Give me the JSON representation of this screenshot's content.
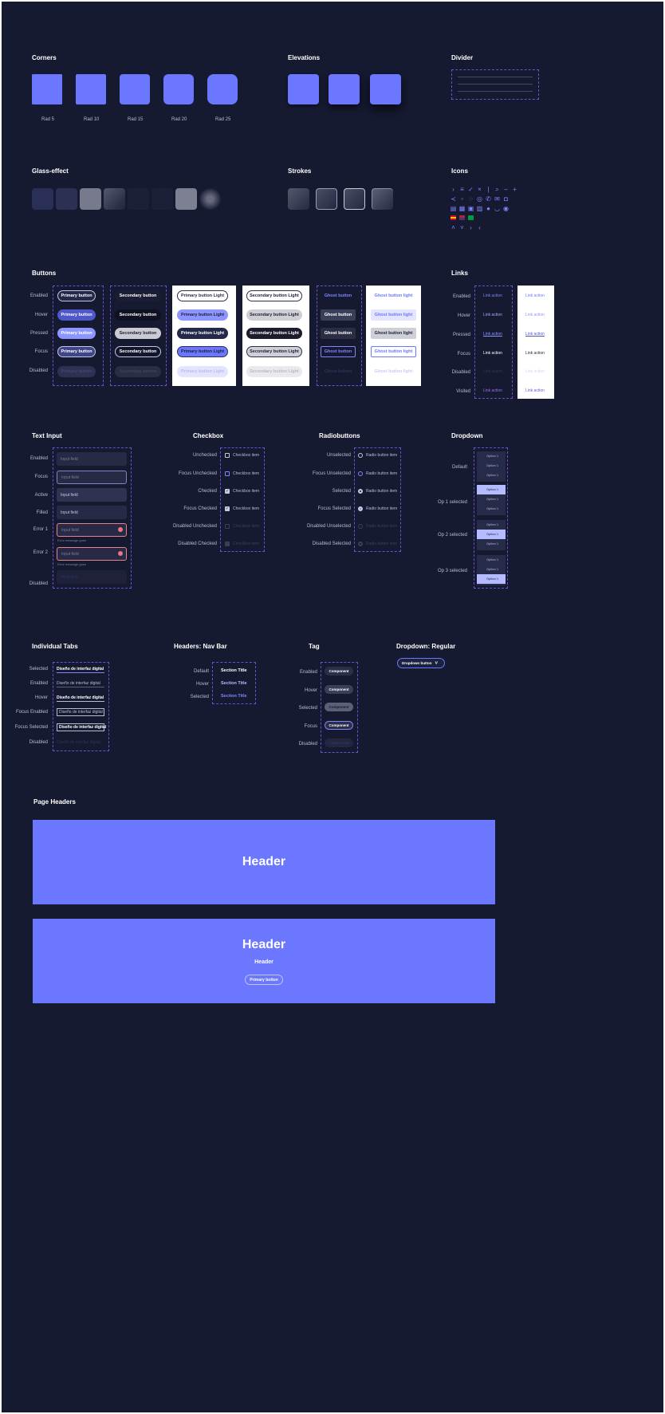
{
  "colors": {
    "bg": "#161a31",
    "accent": "#6c77ff",
    "light": "#b5bbff",
    "dashed": "#6a4fd0"
  },
  "sections": {
    "corners": "Corners",
    "elevations": "Elevations",
    "divider": "Divider",
    "glass": "Glass-effect",
    "strokes": "Strokes",
    "icons": "Icons",
    "buttons": "Buttons",
    "links": "Links",
    "text_input": "Text Input",
    "checkbox": "Checkbox",
    "radio": "Radiobuttons",
    "dropdown": "Dropdown",
    "tabs": "Individual Tabs",
    "navbar": "Headers: Nav Bar",
    "tag": "Tag",
    "dropdown_regular": "Dropdown: Regular",
    "page_headers": "Page Headers"
  },
  "corners": [
    "Rad 5",
    "Rad 10",
    "Rad 15",
    "Rad 20",
    "Rad 25"
  ],
  "states": [
    "Enabled",
    "Hover",
    "Pressed",
    "Focus",
    "Disabled"
  ],
  "buttons": {
    "primary": "Primary button",
    "secondary": "Secondary button",
    "primary_light": "Primary button Light",
    "secondary_light": "Secondary button Light",
    "ghost": "Ghost button",
    "ghost_light": "Ghost button light"
  },
  "links": {
    "states": [
      "Enabled",
      "Hover",
      "Pressed",
      "Focus",
      "Disabled",
      "Visited"
    ],
    "label": "Link action"
  },
  "text_input": {
    "states": [
      "Enabled",
      "Focus",
      "Active",
      "Filled",
      "Error 1",
      "Error 2",
      "Disabled"
    ],
    "values": [
      "Input field",
      "Input field",
      "Input field",
      "Input field",
      "Input field",
      "Input field",
      "Input field"
    ],
    "error_msg": "Error message goes"
  },
  "checkbox": {
    "states": [
      "Unchecked",
      "Focus Unchecked",
      "Checked",
      "Focus Checked",
      "Disabled Unchecked",
      "Disabled Checked"
    ],
    "label": "Checkbox item"
  },
  "radio": {
    "states": [
      "Unselected",
      "Focus Unselected",
      "Selected",
      "Focus Selected",
      "Disabled Unselected",
      "Disabled Selected"
    ],
    "label": "Radio button item"
  },
  "dropdown": {
    "states": [
      "Default",
      "Op 1 selected",
      "Op 2 selected",
      "Op 3 selected"
    ],
    "option": "Option 1"
  },
  "tabs": {
    "states": [
      "Selected",
      "Enabled",
      "Hover",
      "Focus Enabled",
      "Focus Selected",
      "Disabled"
    ],
    "label": "Diseño de interfaz digital"
  },
  "navbar": {
    "states": [
      "Default",
      "Hover",
      "Selected"
    ],
    "label": "Section Title"
  },
  "tag": {
    "states": [
      "Enabled",
      "Hover",
      "Selected",
      "Focus",
      "Disabled"
    ],
    "label": "Component"
  },
  "dropdown_regular": {
    "label": "Dropdown button"
  },
  "page_headers": {
    "header1": "Header",
    "header2": "Header",
    "subheader": "Header",
    "button": "Primary button"
  }
}
